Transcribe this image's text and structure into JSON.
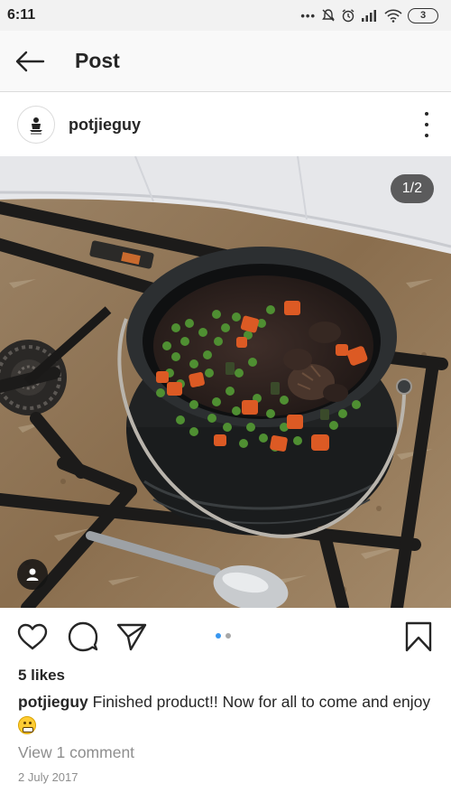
{
  "status_bar": {
    "time": "6:11",
    "battery": "3",
    "icons": [
      "dots-icon",
      "mute-icon",
      "alarm-icon",
      "signal-icon",
      "wifi-icon",
      "battery-icon"
    ]
  },
  "header": {
    "title": "Post",
    "back_icon": "arrow-left-icon"
  },
  "post": {
    "username": "potjieguy",
    "avatar_icon": "potjie-logo-icon",
    "more_icon": "more-vertical-icon",
    "image": {
      "description_icon": "potjie-pot-photo",
      "page_counter": "1/2",
      "tag_icon": "user-tag-icon"
    },
    "actions": {
      "like_icon": "heart-icon",
      "comment_icon": "comment-icon",
      "share_icon": "send-icon",
      "save_icon": "bookmark-icon"
    },
    "carousel": {
      "count": 2,
      "active": 0,
      "active_color": "#3897f0",
      "inactive_color": "#a8a8a8"
    },
    "likes": "5 likes",
    "caption_user": "potjieguy",
    "caption_text": "Finished product!! Now for all to come and enjoy",
    "caption_emoji": "grimacing-emoji-icon",
    "view_comments": "View 1 comment",
    "date": "2 July 2017"
  }
}
